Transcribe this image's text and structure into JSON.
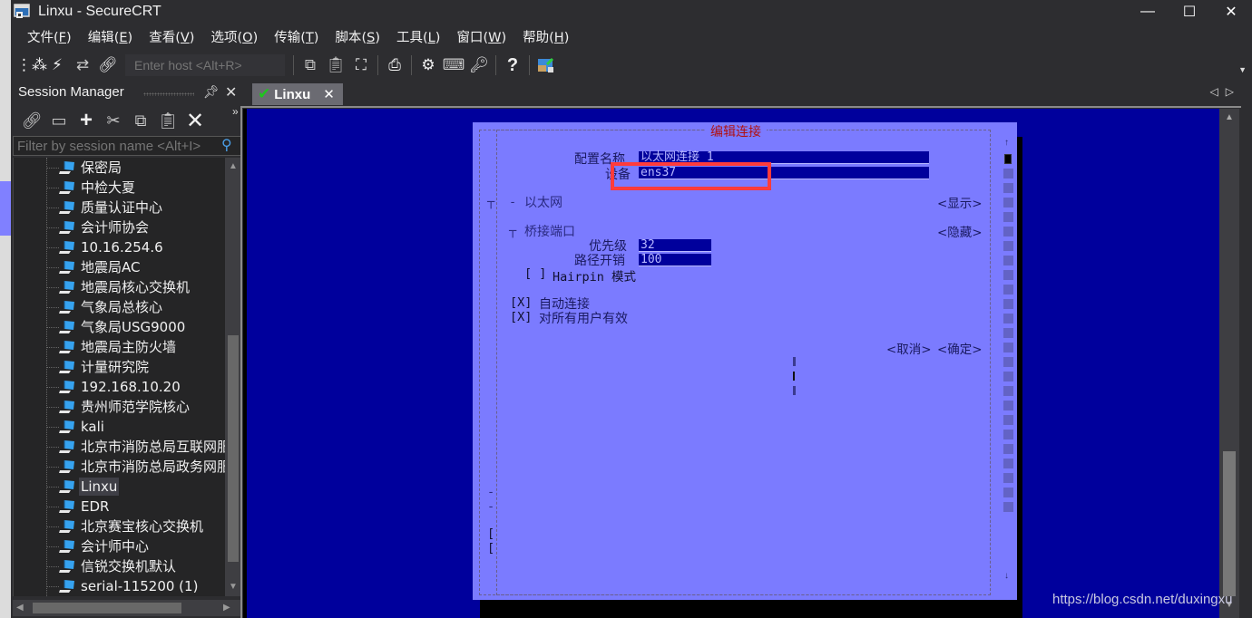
{
  "window": {
    "title": "Linxu - SecureCRT",
    "minimize": "—",
    "maximize": "☐",
    "close": "✕"
  },
  "menu": [
    {
      "label": "文件",
      "key": "F"
    },
    {
      "label": "编辑",
      "key": "E"
    },
    {
      "label": "查看",
      "key": "V"
    },
    {
      "label": "选项",
      "key": "O"
    },
    {
      "label": "传输",
      "key": "T"
    },
    {
      "label": "脚本",
      "key": "S"
    },
    {
      "label": "工具",
      "key": "L"
    },
    {
      "label": "窗口",
      "key": "W"
    },
    {
      "label": "帮助",
      "key": "H"
    }
  ],
  "toolbar": {
    "host_placeholder": "Enter host <Alt+R>"
  },
  "session_manager": {
    "title": "Session Manager",
    "filter_placeholder": "Filter by session name <Alt+I>",
    "sessions": [
      "保密局",
      "中检大夏",
      "质量认证中心",
      "会计师协会",
      "10.16.254.6",
      "地震局AC",
      "地震局核心交换机",
      "气象局总核心",
      "气象局USG9000",
      "地震局主防火墙",
      "计量研究院",
      "192.168.10.20",
      "贵州师范学院核心",
      "kali",
      "北京市消防总局互联网服",
      "北京市消防总局政务网服",
      "Linxu",
      "EDR",
      "北京赛宝核心交换机",
      "会计师中心",
      "信锐交换机默认",
      "serial-115200 (1)"
    ],
    "selected": "Linxu"
  },
  "tabs": [
    {
      "label": "Linxu",
      "status": "connected",
      "close": "✕"
    }
  ],
  "terminal": {
    "dialog_title": "编辑连接",
    "profile_name_label": "配置名称",
    "profile_name_value": "以太网连接 1",
    "device_label": "设备",
    "device_value": "ens37",
    "ethernet_section": "以太网",
    "ethernet_toggle": "<显示>",
    "bridge_port_section": "桥接端口",
    "bridge_port_toggle": "<隐藏>",
    "priority_label": "优先级",
    "priority_value": "32",
    "path_cost_label": "路径开销",
    "path_cost_value": "100",
    "hairpin_checkbox": "[ ]",
    "hairpin_label": "Hairpin 模式",
    "auto_connect_checkbox": "[X]",
    "auto_connect_label": "自动连接",
    "all_users_checkbox": "[X]",
    "all_users_label": "对所有用户有效",
    "cancel_button": "<取消>",
    "ok_button": "<确定>"
  },
  "watermark": "https://blog.csdn.net/duxingxu",
  "colors": {
    "terminal_bg": "#00009c",
    "dialog_bg": "#7b7bff",
    "highlight_box": "#ff3b3b",
    "tab_check": "#1ec51e"
  }
}
